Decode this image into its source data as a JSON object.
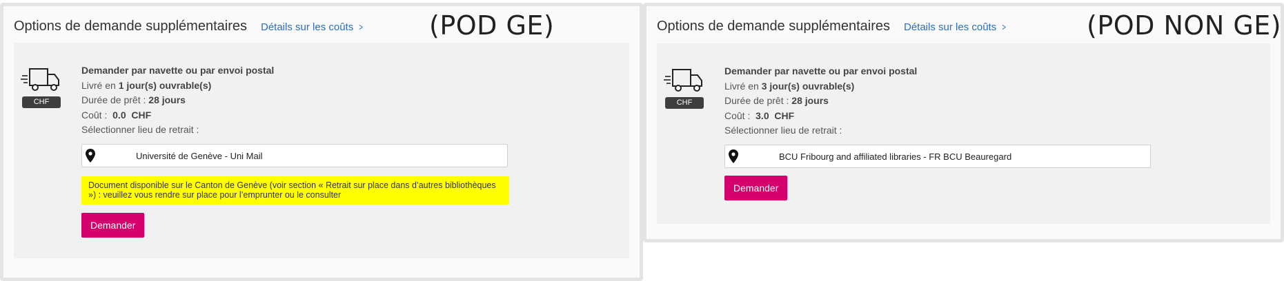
{
  "panels": [
    {
      "title": "Options de demande supplémentaires",
      "cost_link": "Détails sur les coûts",
      "corner_label": "(POD GE)",
      "delivery_method": "Demander par navette ou par envoi postal",
      "delivered_prefix": "Livré en",
      "delivered_value": "1 jour(s) ouvrable(s)",
      "loan_prefix": "Durée de prêt :",
      "loan_value": "28 jours",
      "cost_prefix": "Coût :",
      "cost_value": "0.0  CHF",
      "pickup_label": "Sélectionner lieu de retrait :",
      "pickup_location": "Université de Genève - Uni Mail",
      "notice": "Document disponible sur le Canton de Genève (voir section « Retrait sur place dans d’autres bibliothèques ») : veuillez vous rendre sur place pour l’emprunter ou le consulter",
      "currency_badge": "CHF",
      "request_button": "Demander"
    },
    {
      "title": "Options de demande supplémentaires",
      "cost_link": "Détails sur les coûts",
      "corner_label": "(POD NON GE)",
      "delivery_method": "Demander par navette ou par envoi postal",
      "delivered_prefix": "Livré en",
      "delivered_value": "3 jour(s) ouvrable(s)",
      "loan_prefix": "Durée de prêt :",
      "loan_value": "28 jours",
      "cost_prefix": "Coût :",
      "cost_value": "3.0  CHF",
      "pickup_label": "Sélectionner lieu de retrait :",
      "pickup_location": "BCU Fribourg and affiliated libraries - FR BCU Beauregard",
      "currency_badge": "CHF",
      "request_button": "Demander"
    }
  ],
  "icons": {
    "truck": "truck-icon",
    "pin": "map-pin-icon",
    "chevron": "chevron-right-icon"
  },
  "colors": {
    "link": "#2a6ebb",
    "button": "#d4006b",
    "notice_bg": "#ffff00",
    "badge_bg": "#3e3e3e"
  }
}
